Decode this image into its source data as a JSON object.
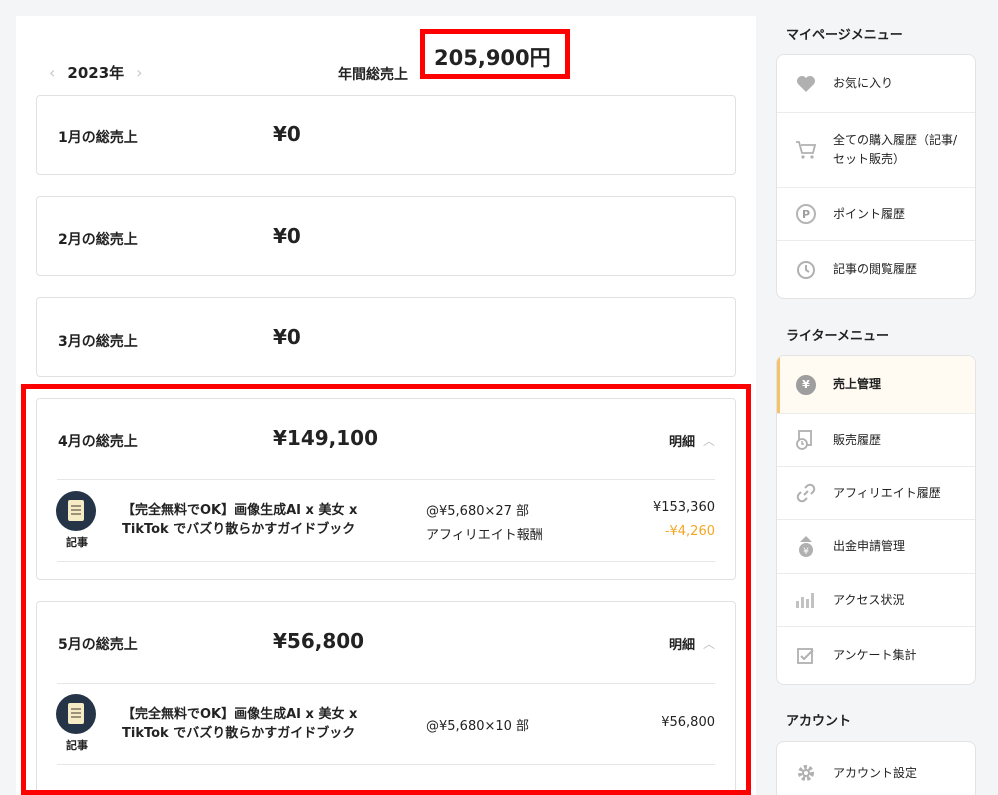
{
  "header": {
    "prev_symbol": "‹",
    "next_symbol": "›",
    "year": "2023年",
    "annual_label": "年間総売上",
    "annual_value": "205,900円"
  },
  "months": [
    {
      "label": "1月の総売上",
      "amount": "¥0"
    },
    {
      "label": "2月の総売上",
      "amount": "¥0"
    },
    {
      "label": "3月の総売上",
      "amount": "¥0"
    },
    {
      "label": "4月の総売上",
      "amount": "¥149,100",
      "detail_label": "明細",
      "item": {
        "kind": "記事",
        "title": "【完全無料でOK】画像生成AI x 美女 x TikTok でバズり散らかすガイドブック",
        "unit": "@¥5,680×27 部",
        "price": "¥153,360",
        "affiliate_label": "アフィリエイト報酬",
        "affiliate_value": "-¥4,260"
      }
    },
    {
      "label": "5月の総売上",
      "amount": "¥56,800",
      "detail_label": "明細",
      "item": {
        "kind": "記事",
        "title": "【完全無料でOK】画像生成AI x 美女 x TikTok でバズり散らかすガイドブック",
        "unit": "@¥5,680×10 部",
        "price": "¥56,800"
      }
    }
  ],
  "sidebar": {
    "mypage_heading": "マイページメニュー",
    "mypage_items": [
      {
        "label": "お気に入り",
        "icon": "heart-icon"
      },
      {
        "label": "全ての購入履歴（記事/セット販売）",
        "icon": "cart-icon"
      },
      {
        "label": "ポイント履歴",
        "icon": "point-icon"
      },
      {
        "label": "記事の閲覧履歴",
        "icon": "clock-icon"
      }
    ],
    "writer_heading": "ライターメニュー",
    "writer_items": [
      {
        "label": "売上管理",
        "icon": "yen-icon"
      },
      {
        "label": "販売履歴",
        "icon": "sales-history-icon"
      },
      {
        "label": "アフィリエイト履歴",
        "icon": "link-icon"
      },
      {
        "label": "出金申請管理",
        "icon": "withdraw-icon"
      },
      {
        "label": "アクセス状況",
        "icon": "bar-chart-icon"
      },
      {
        "label": "アンケート集計",
        "icon": "checkbox-icon"
      }
    ],
    "account_heading": "アカウント",
    "account_items": [
      {
        "label": "アカウント設定",
        "icon": "gear-icon"
      }
    ]
  },
  "colors": {
    "highlight": "#ff0000",
    "affiliate_negative": "#f5a623",
    "active_accent": "#f5c26b"
  }
}
